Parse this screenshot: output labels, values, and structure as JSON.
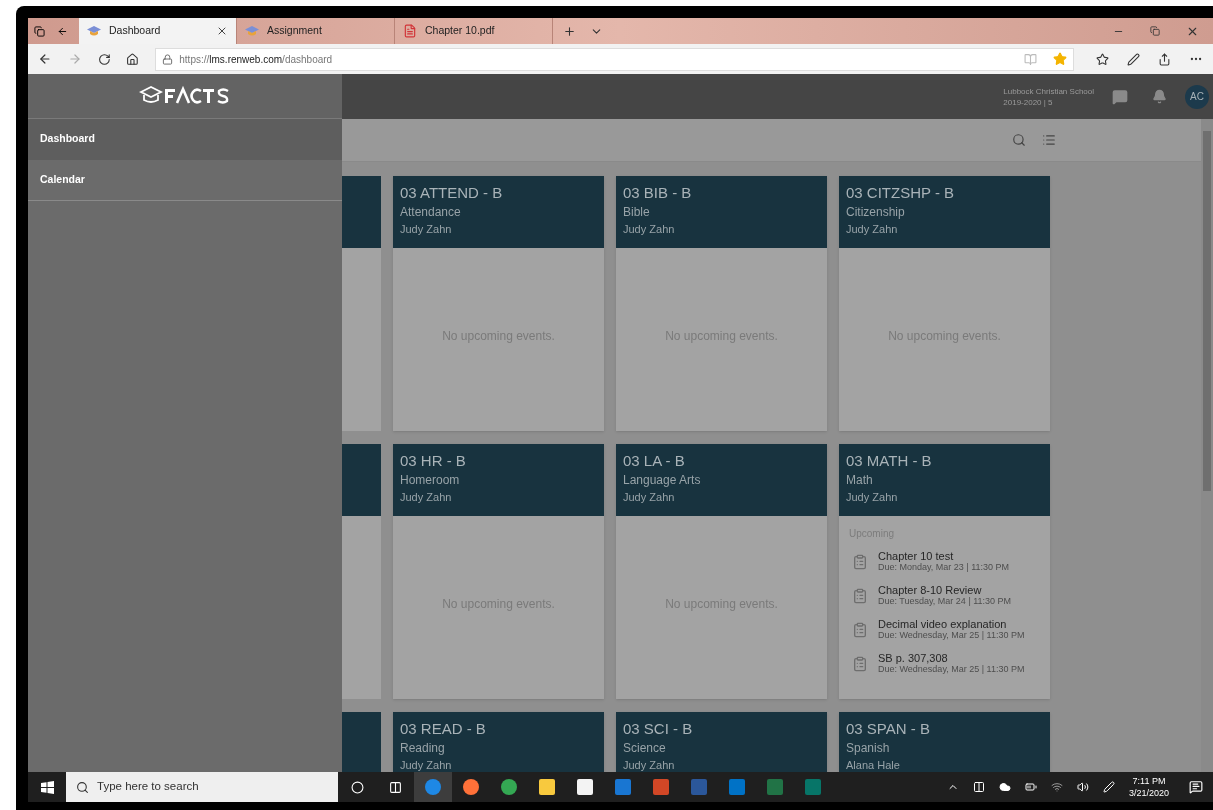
{
  "browser": {
    "tabs": [
      {
        "title": "Dashboard",
        "kind": "site",
        "selected": true
      },
      {
        "title": "Assignment",
        "kind": "site",
        "selected": false
      },
      {
        "title": "Chapter 10.pdf",
        "kind": "pdf",
        "selected": false
      }
    ],
    "address": {
      "scheme": "https://",
      "host": "lms.renweb.com",
      "path": "/dashboard"
    }
  },
  "header": {
    "school": "Lubbock Christian School",
    "term": "2019-2020 | 5",
    "avatar": "AC"
  },
  "sidebar": {
    "items": [
      {
        "label": "Dashboard",
        "selected": true
      },
      {
        "label": "Calendar",
        "selected": false
      }
    ]
  },
  "card_rows": [
    [
      {
        "code": "03 ATTEND - B",
        "subject": "Attendance",
        "teacher": "Judy Zahn",
        "empty_text": "No upcoming events."
      },
      {
        "code": "03 BIB - B",
        "subject": "Bible",
        "teacher": "Judy Zahn",
        "empty_text": "No upcoming events."
      },
      {
        "code": "03 CITZSHP - B",
        "subject": "Citizenship",
        "teacher": "Judy Zahn",
        "empty_text": "No upcoming events."
      }
    ],
    [
      {
        "code": "03 HR - B",
        "subject": "Homeroom",
        "teacher": "Judy Zahn",
        "empty_text": "No upcoming events."
      },
      {
        "code": "03 LA - B",
        "subject": "Language Arts",
        "teacher": "Judy Zahn",
        "empty_text": "No upcoming events."
      },
      {
        "code": "03 MATH - B",
        "subject": "Math",
        "teacher": "Judy Zahn",
        "upcoming_heading": "Upcoming",
        "events": [
          {
            "title": "Chapter 10 test",
            "due": "Due: Monday, Mar 23 | 11:30 PM"
          },
          {
            "title": "Chapter 8-10 Review",
            "due": "Due: Tuesday, Mar 24 | 11:30 PM"
          },
          {
            "title": "Decimal video explanation",
            "due": "Due: Wednesday, Mar 25 | 11:30 PM"
          },
          {
            "title": "SB p. 307,308",
            "due": "Due: Wednesday, Mar 25 | 11:30 PM"
          }
        ]
      }
    ],
    [
      {
        "code": "03 READ - B",
        "subject": "Reading",
        "teacher": "Judy Zahn"
      },
      {
        "code": "03 SCI - B",
        "subject": "Science",
        "teacher": "Judy Zahn"
      },
      {
        "code": "03 SPAN - B",
        "subject": "Spanish",
        "teacher": "Alana Hale"
      }
    ]
  ],
  "taskbar": {
    "search": {
      "placeholder": "Type here to search"
    },
    "time": "7:11 PM",
    "date": "3/21/2020"
  }
}
